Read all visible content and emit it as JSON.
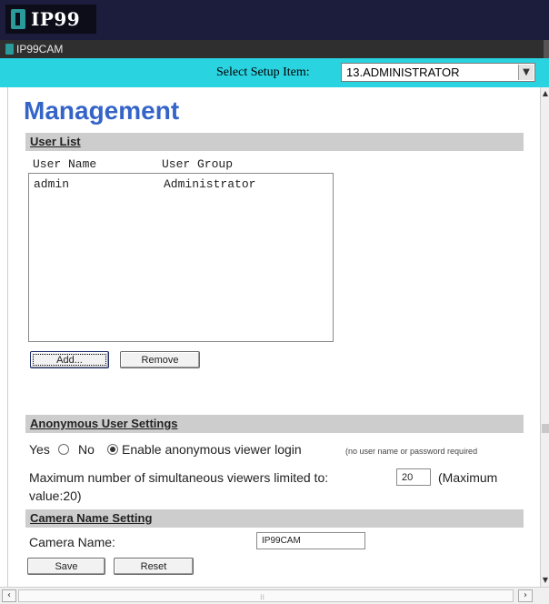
{
  "header": {
    "logo_text": "IP99",
    "camera_label": "IP99CAM"
  },
  "setup": {
    "label": "Select Setup Item:",
    "selected": "13.ADMINISTRATOR"
  },
  "page": {
    "title": "Management"
  },
  "user_list": {
    "section_title": "User List",
    "columns": [
      "User Name",
      "User Group"
    ],
    "rows": [
      {
        "name": "admin",
        "group": "Administrator"
      }
    ],
    "add_label": "Add...",
    "remove_label": "Remove"
  },
  "anonymous": {
    "section_title": "Anonymous User Settings",
    "yes_label": "Yes",
    "no_label": "No",
    "enable_label": "Enable anonymous viewer login",
    "enable_note": "(no user name or password required",
    "max_label": "Maximum number of simultaneous viewers limited to:",
    "max_value": "20",
    "max_hint": "(Maximum",
    "max_hint2": "value:20)"
  },
  "camera_name": {
    "section_title": "Camera Name Setting",
    "label": "Camera Name:",
    "value": "IP99CAM",
    "save_label": "Save",
    "reset_label": "Reset"
  },
  "icons": {
    "select_arrow": "chevron-down-icon",
    "scroll_up": "triangle-up-icon",
    "scroll_down": "triangle-down-icon",
    "scroll_left": "chevron-left-icon",
    "scroll_right": "chevron-right-icon"
  },
  "colors": {
    "header_bg": "#1c1c3c",
    "setup_bar_bg": "#2ad3e0",
    "title_color": "#3464c8",
    "section_bg": "#cdcdcd"
  }
}
